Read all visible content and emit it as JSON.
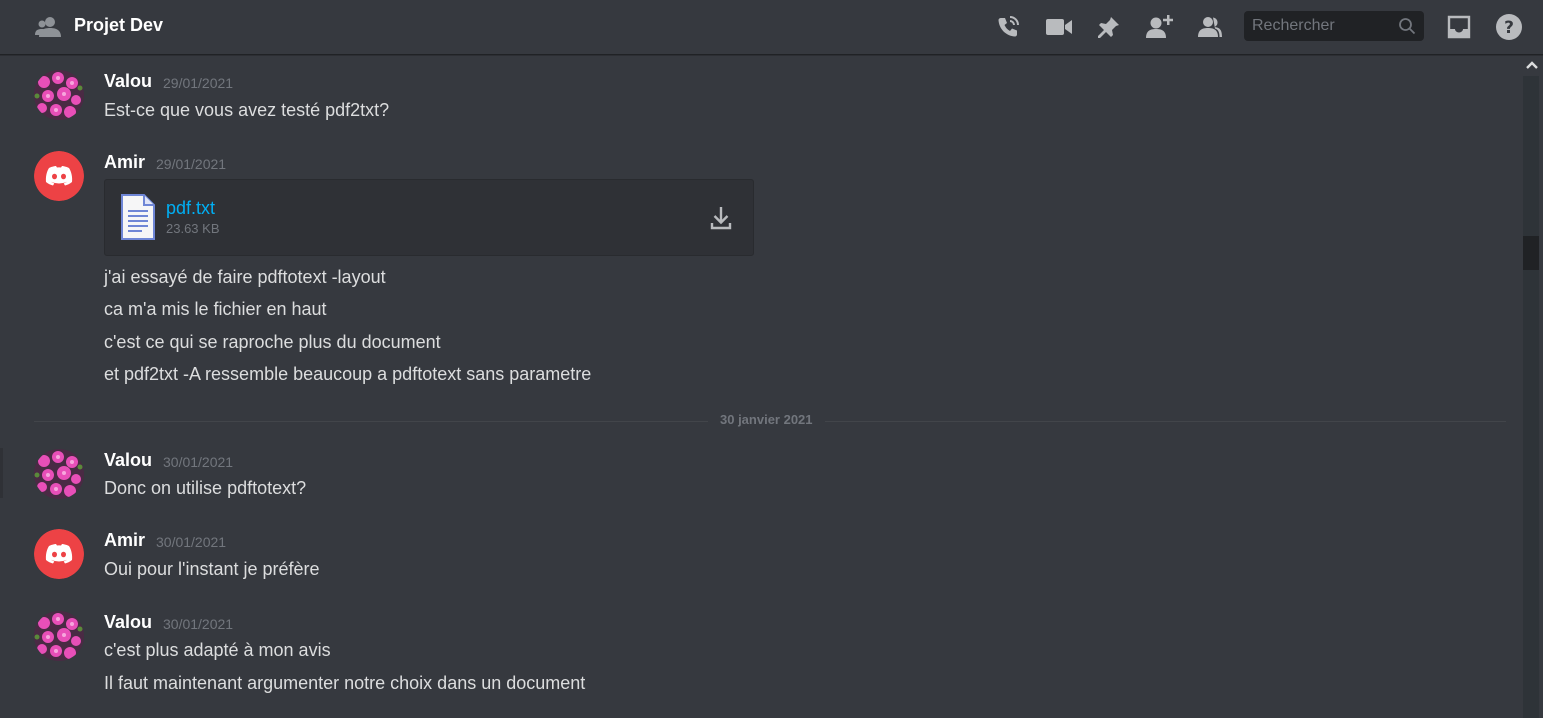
{
  "header": {
    "title": "Projet Dev",
    "search_placeholder": "Rechercher",
    "icons": [
      "group-dm-icon",
      "voice-call-icon",
      "video-call-icon",
      "pin-icon",
      "add-friend-icon",
      "members-icon",
      "search-icon",
      "inbox-icon",
      "help-icon"
    ]
  },
  "messages": [
    {
      "author": "Valou",
      "time": "29/01/2021",
      "lines": [
        "Est-ce que vous avez testé pdf2txt?"
      ]
    },
    {
      "author": "Amir",
      "time": "29/01/2021",
      "attachment": {
        "name": "pdf.txt",
        "size": "23.63 KB"
      },
      "lines": [
        "j'ai essayé de faire pdftotext -layout",
        "ca m'a mis le fichier en haut",
        "c'est ce qui se raproche plus du document",
        "et pdf2txt -A ressemble beaucoup a pdftotext sans parametre"
      ]
    },
    {
      "author": "Valou",
      "time": "30/01/2021",
      "lines": [
        "Donc on utilise pdftotext?"
      ]
    },
    {
      "author": "Amir",
      "time": "30/01/2021",
      "lines": [
        "Oui pour l'instant je préfère"
      ]
    },
    {
      "author": "Valou",
      "time": "30/01/2021",
      "lines": [
        "c'est plus adapté à mon avis",
        "Il faut maintenant argumenter notre choix dans un document"
      ]
    }
  ],
  "date_divider": "30 janvier 2021",
  "colors": {
    "background": "#36393f",
    "header_text": "#ffffff",
    "message_text": "#dcddde",
    "muted": "#72767d",
    "link": "#00aff4",
    "amir_avatar": "#ed4245"
  }
}
